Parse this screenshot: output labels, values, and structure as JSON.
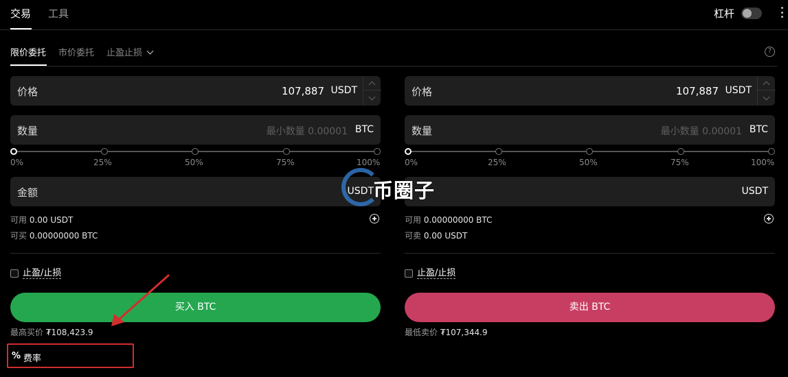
{
  "top_tabs": [
    {
      "label": "交易",
      "active": true
    },
    {
      "label": "工具",
      "active": false
    }
  ],
  "leverage": {
    "label": "杠杆",
    "enabled": false
  },
  "order_tabs": [
    {
      "label": "限价委托",
      "active": true
    },
    {
      "label": "市价委托",
      "active": false
    },
    {
      "label": "止盈止损",
      "active": false
    }
  ],
  "buy": {
    "price_label": "价格",
    "price_value": "107,887",
    "price_unit": "USDT",
    "qty_label": "数量",
    "qty_placeholder": "最小数量 0.00001",
    "qty_unit": "BTC",
    "slider_labels": [
      "0%",
      "25%",
      "50%",
      "75%",
      "100%"
    ],
    "slider_value_percent": 0,
    "amount_label": "金额",
    "amount_unit": "USDT",
    "available_label": "可用",
    "available_value": "0.00 USDT",
    "can_trade_label": "可买",
    "can_trade_value": "0.00000000 BTC",
    "tpsl_label": "止盈/止损",
    "button_label": "买入 BTC",
    "best_price_label": "最高买价",
    "best_price_value": "₮108,423.9"
  },
  "sell": {
    "price_label": "价格",
    "price_value": "107,887",
    "price_unit": "USDT",
    "qty_label": "数量",
    "qty_placeholder": "最小数量 0.00001",
    "qty_unit": "BTC",
    "slider_labels": [
      "0%",
      "25%",
      "50%",
      "75%",
      "100%"
    ],
    "slider_value_percent": 0,
    "amount_unit": "USDT",
    "available_label": "可用",
    "available_value": "0.00000000 BTC",
    "can_trade_label": "可卖",
    "can_trade_value": "0.00 USDT",
    "tpsl_label": "止盈/止损",
    "button_label": "卖出 BTC",
    "best_price_label": "最低卖价",
    "best_price_value": "₮107,344.9"
  },
  "fee": {
    "icon": "%",
    "label": "费率"
  },
  "watermark": {
    "text": "币圈子"
  },
  "colors": {
    "buy": "#25a750",
    "sell": "#c83e62",
    "highlight_box": "#d32d2d",
    "background": "#000000"
  }
}
